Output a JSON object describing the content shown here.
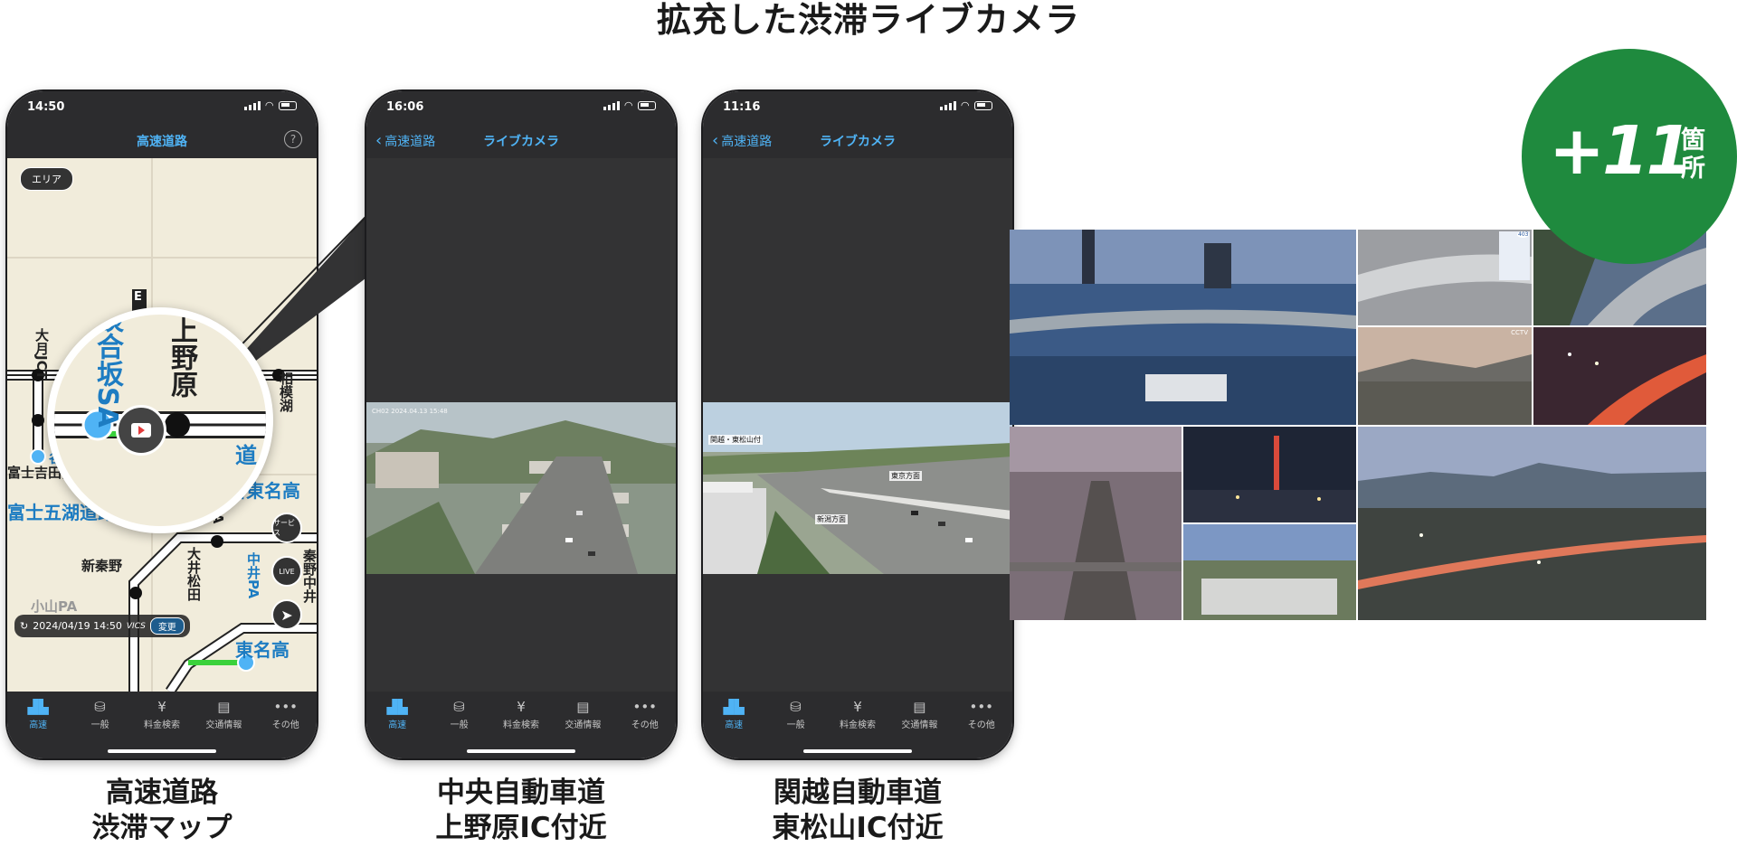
{
  "headline": "拡充した渋滞ライブカメラ",
  "phone1": {
    "time": "14:50",
    "nav_title": "高速道路",
    "area_button": "エリア",
    "map_labels": {
      "label_a": "大月JCT",
      "label_b": "相模湖",
      "label_c": "富士吉田西",
      "label_d": "富士五湖道路",
      "label_e": "新東名高",
      "label_f": "新秦野",
      "label_g": "大井松田",
      "label_h": "中井PA",
      "label_i": "秦野中井",
      "label_j": "小山PA",
      "label_k": "東名高",
      "label_l": "谷村",
      "label_m": "SA",
      "label_n": "E"
    },
    "magnifier": {
      "left_text": "談合坂SA",
      "right_text": "上野原",
      "side_text": "道"
    },
    "timestamp": "2024/04/19 14:50",
    "timestamp_source": "VICS",
    "timestamp_change": "変更",
    "fab_service": "サービス",
    "fab_live": "LIVE"
  },
  "phone2": {
    "time": "16:06",
    "nav_back": "高速道路",
    "nav_title": "ライブカメラ",
    "camera_stamp": "CH02 2024.04.13 15:48"
  },
  "phone3": {
    "time": "11:16",
    "nav_back": "高速道路",
    "nav_title": "ライブカメラ",
    "camera_site": "関越・東松山付",
    "direction_1": "東京方面",
    "direction_2": "新潟方面"
  },
  "tabs": [
    {
      "label": "高速",
      "icon": "highway-icon"
    },
    {
      "label": "一般",
      "icon": "general-road-icon"
    },
    {
      "label": "料金検索",
      "icon": "yen-icon"
    },
    {
      "label": "交通情報",
      "icon": "document-icon"
    },
    {
      "label": "その他",
      "icon": "more-icon"
    }
  ],
  "captions": [
    {
      "line1": "高速道路",
      "line2": "渋滞マップ"
    },
    {
      "line1": "中央自動車道",
      "line2": "上野原IC付近"
    },
    {
      "line1": "関越自動車道",
      "line2": "東松山IC付近"
    }
  ],
  "badge": {
    "count": "+11",
    "unit": "箇所"
  },
  "collage_tags": {
    "cctv": "CCTV",
    "sign": "403"
  },
  "colors": {
    "accent_blue": "#4fb3f5",
    "badge_green": "#1f8a3e",
    "phone_dark": "#2c2c2e",
    "map_bg": "#f1ecdb"
  }
}
